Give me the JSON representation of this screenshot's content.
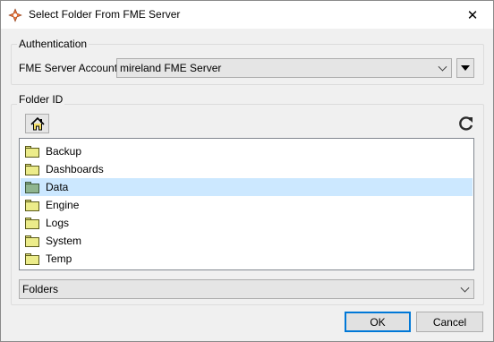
{
  "window": {
    "title": "Select Folder From FME Server",
    "close_glyph": "✕",
    "app_icon": "fme-workbench-icon"
  },
  "authentication": {
    "group_title": "Authentication",
    "account_label": "FME Server Account:",
    "account_value": "mireland FME Server"
  },
  "folder_id": {
    "group_title": "Folder ID",
    "items": [
      {
        "label": "Backup",
        "selected": false
      },
      {
        "label": "Dashboards",
        "selected": false
      },
      {
        "label": "Data",
        "selected": true
      },
      {
        "label": "Engine",
        "selected": false
      },
      {
        "label": "Logs",
        "selected": false
      },
      {
        "label": "System",
        "selected": false
      },
      {
        "label": "Temp",
        "selected": false
      }
    ],
    "filter_value": "Folders"
  },
  "buttons": {
    "ok": "OK",
    "cancel": "Cancel"
  },
  "colors": {
    "selection": "#cce8ff",
    "folder_yellow": "#ecec8a",
    "folder_green": "#8fb58f",
    "accent": "#0078d7"
  }
}
